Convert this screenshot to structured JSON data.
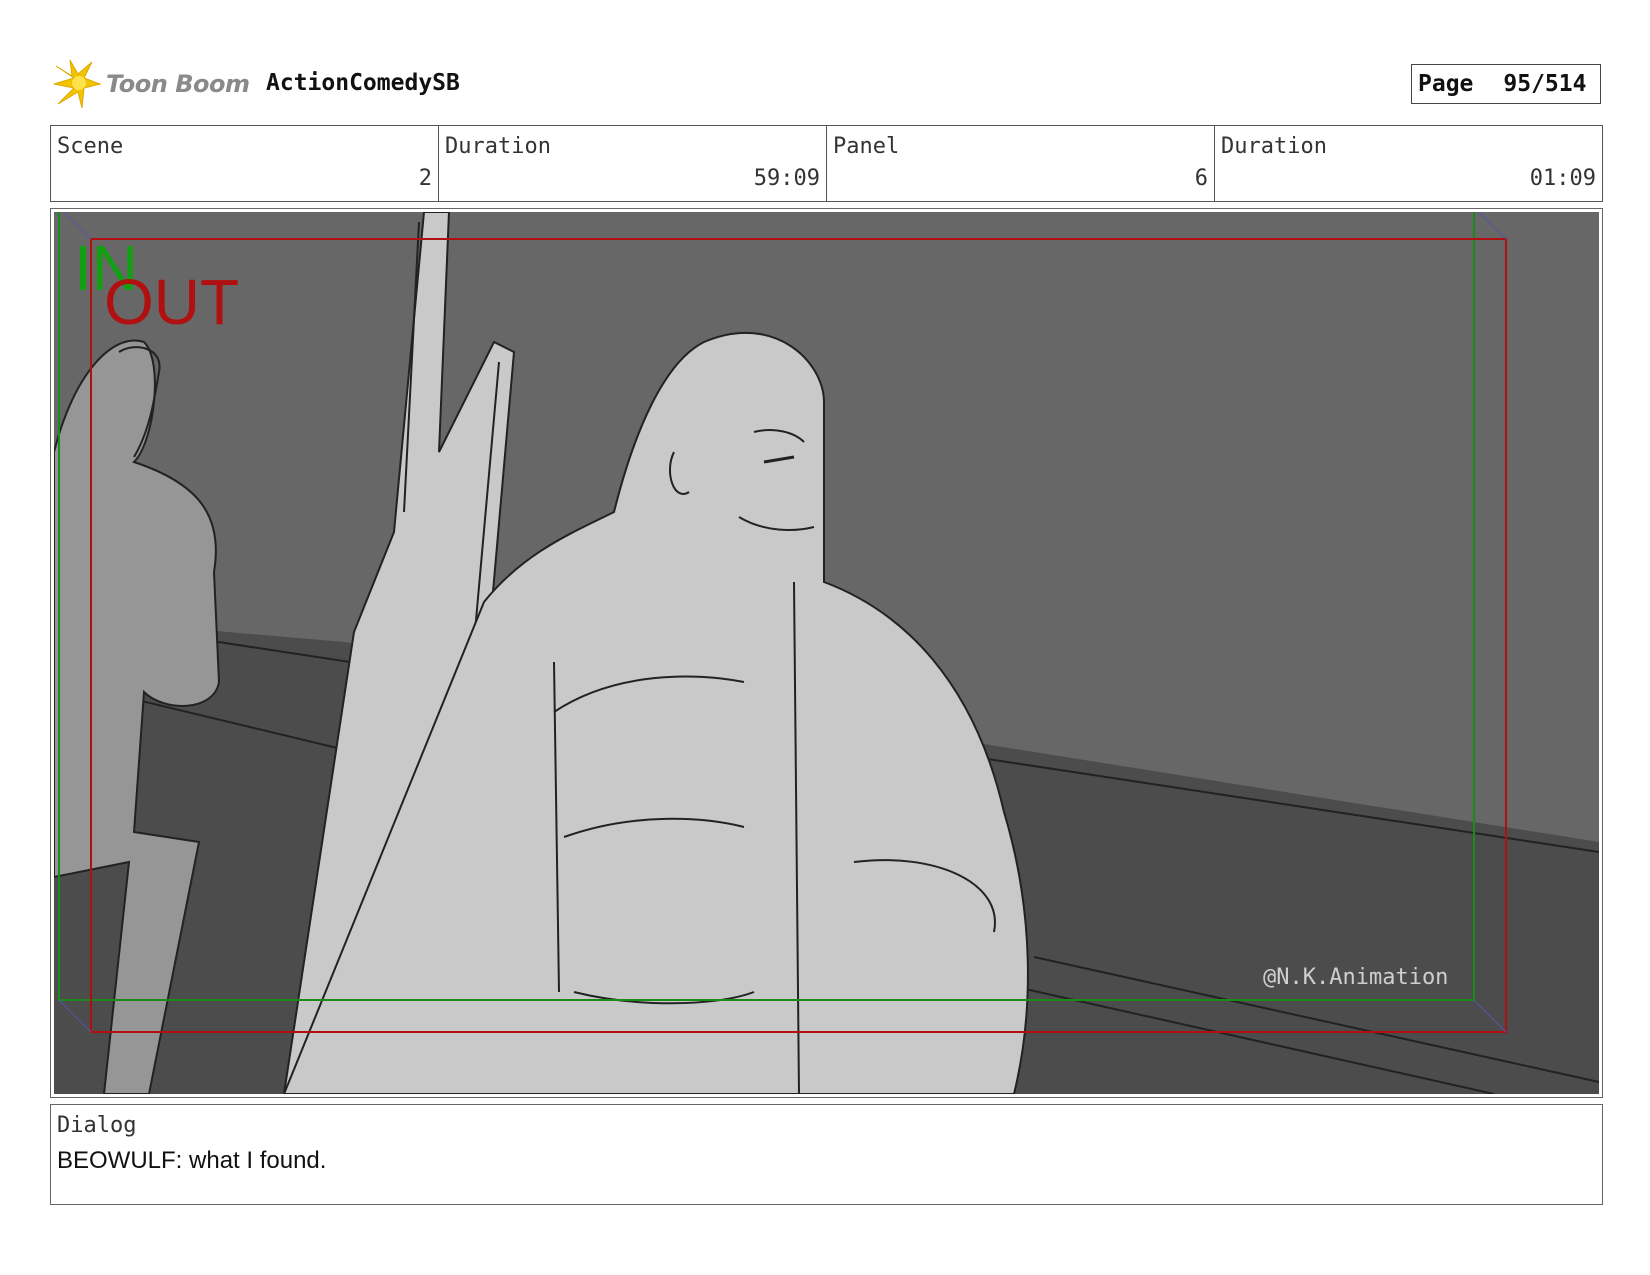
{
  "header": {
    "logo_text": "Toon Boom",
    "project_title": "ActionComedySB",
    "page_label": "Page",
    "page_number": "95/514"
  },
  "info": {
    "scene_label": "Scene",
    "scene_value": "2",
    "scene_duration_label": "Duration",
    "scene_duration_value": "59:09",
    "panel_label": "Panel",
    "panel_value": "6",
    "panel_duration_label": "Duration",
    "panel_duration_value": "01:09"
  },
  "panel": {
    "in_marker": "IN",
    "out_marker": "OUT",
    "watermark": "@N.K.Animation",
    "colors": {
      "background": "#676767",
      "floor": "#4c4c4c",
      "in_frame": "#1a8a1a",
      "out_frame": "#b01010",
      "figure_fill": "#c9c9c9",
      "bg_figure_fill": "#969696"
    }
  },
  "dialog": {
    "label": "Dialog",
    "text": "BEOWULF:  what I found."
  }
}
